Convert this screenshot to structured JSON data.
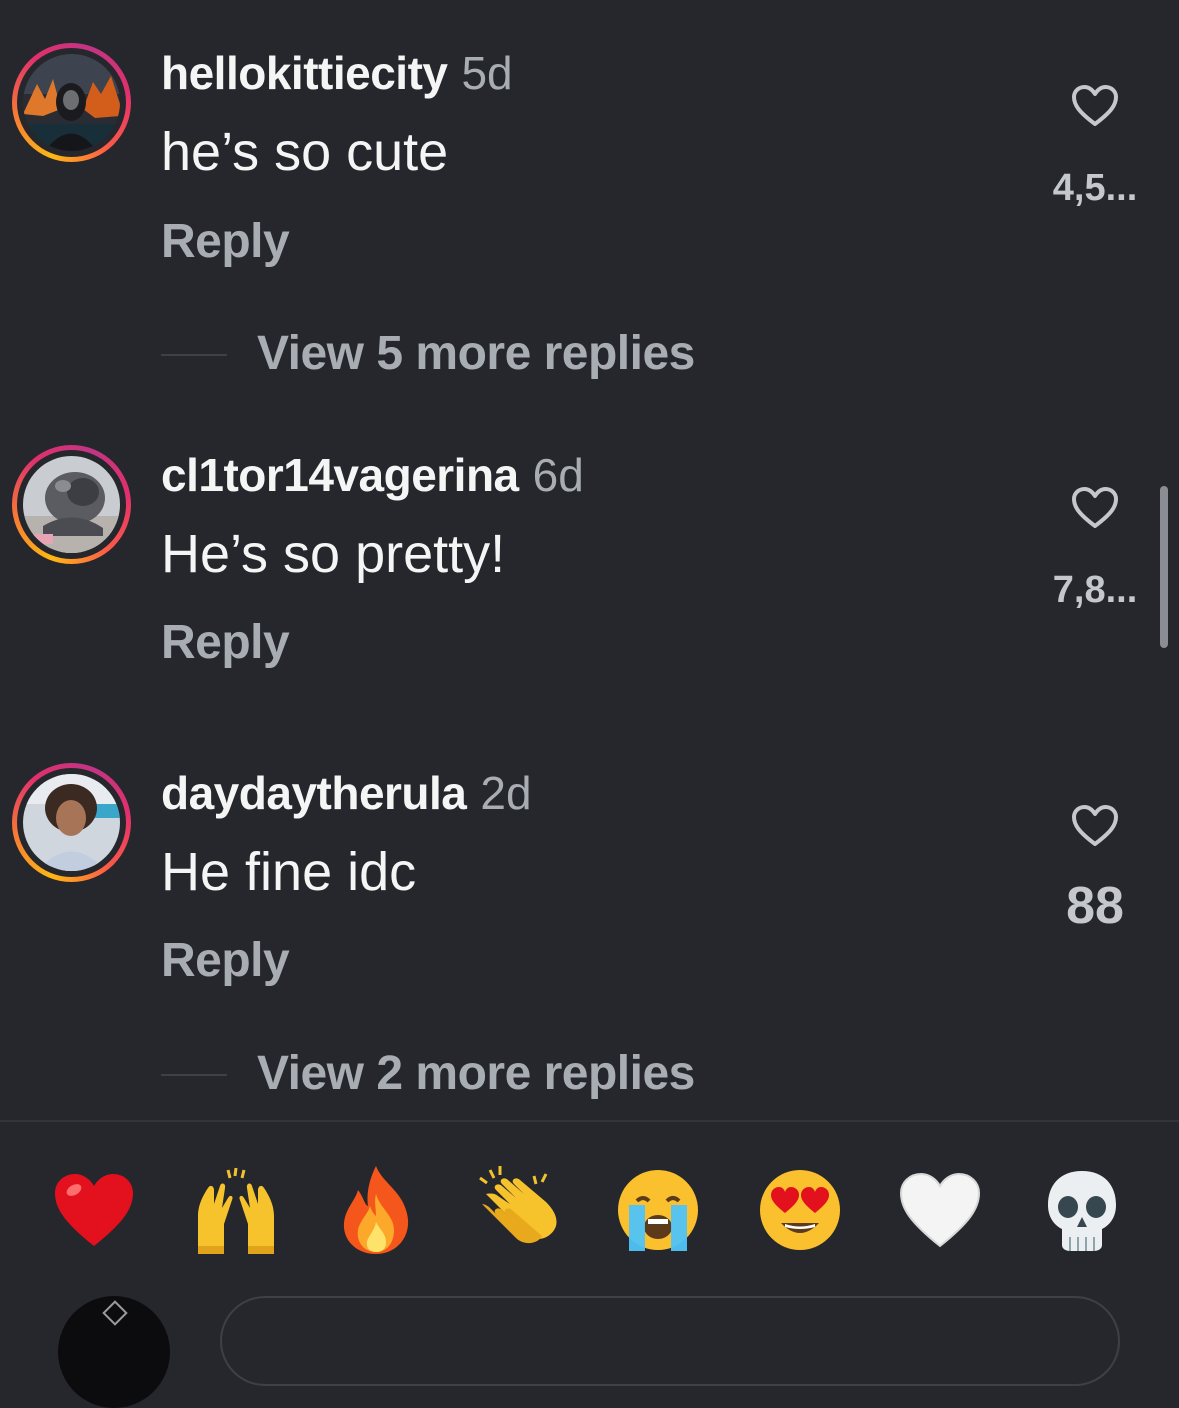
{
  "comments": [
    {
      "username": "hellokittiecity",
      "time": "5d",
      "text": "he’s so cute",
      "reply_label": "Reply",
      "likes": "4,5...",
      "view_more": "View 5 more replies"
    },
    {
      "username": "cl1tor14vagerina",
      "time": "6d",
      "text": "He’s so pretty!",
      "reply_label": "Reply",
      "likes": "7,8..."
    },
    {
      "username": "daydaytherula",
      "time": "2d",
      "text": "He fine idc",
      "reply_label": "Reply",
      "likes": "88",
      "view_more": "View 2 more replies"
    }
  ],
  "emoji_bar": {
    "items": [
      {
        "name": "red-heart",
        "glyph": "❤️"
      },
      {
        "name": "raising-hands",
        "glyph": "🙌"
      },
      {
        "name": "fire",
        "glyph": "🔥"
      },
      {
        "name": "clapping-hands",
        "glyph": "👏"
      },
      {
        "name": "loudly-crying-face",
        "glyph": "😭"
      },
      {
        "name": "heart-eyes",
        "glyph": "😍"
      },
      {
        "name": "white-heart",
        "glyph": "🤍"
      },
      {
        "name": "skull",
        "glyph": "💀"
      }
    ]
  },
  "colors": {
    "background": "#25272c",
    "primary_text": "#f5f5f5",
    "secondary_text": "#a8acb3",
    "story_ring_start": "#fdb813",
    "story_ring_end": "#c13584"
  },
  "icons": [
    "heart-outline-icon",
    "story-ring-avatar"
  ]
}
